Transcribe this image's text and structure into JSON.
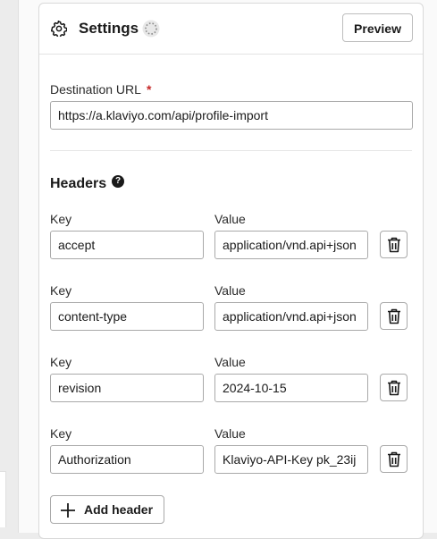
{
  "settings": {
    "title": "Settings",
    "preview_label": "Preview",
    "destination_url_label": "Destination URL",
    "required_mark": "*",
    "destination_url_value": "https://a.klaviyo.com/api/profile-import"
  },
  "headers": {
    "title": "Headers",
    "help_glyph": "?",
    "key_label": "Key",
    "value_label": "Value",
    "rows": [
      {
        "key": "accept",
        "value": "application/vnd.api+json"
      },
      {
        "key": "content-type",
        "value": "application/vnd.api+json"
      },
      {
        "key": "revision",
        "value": "2024-10-15"
      },
      {
        "key": "Authorization",
        "value": "Klaviyo-API-Key pk_23ij"
      }
    ],
    "add_label": "Add header"
  },
  "icons": {
    "settings": "gear-icon",
    "status": "loading-spinner-icon",
    "help": "question-circle-icon",
    "delete": "trash-icon",
    "add": "plus-icon"
  },
  "colors": {
    "required": "#c62828",
    "border": "#a9a9a9",
    "text": "#1a1a1a"
  }
}
